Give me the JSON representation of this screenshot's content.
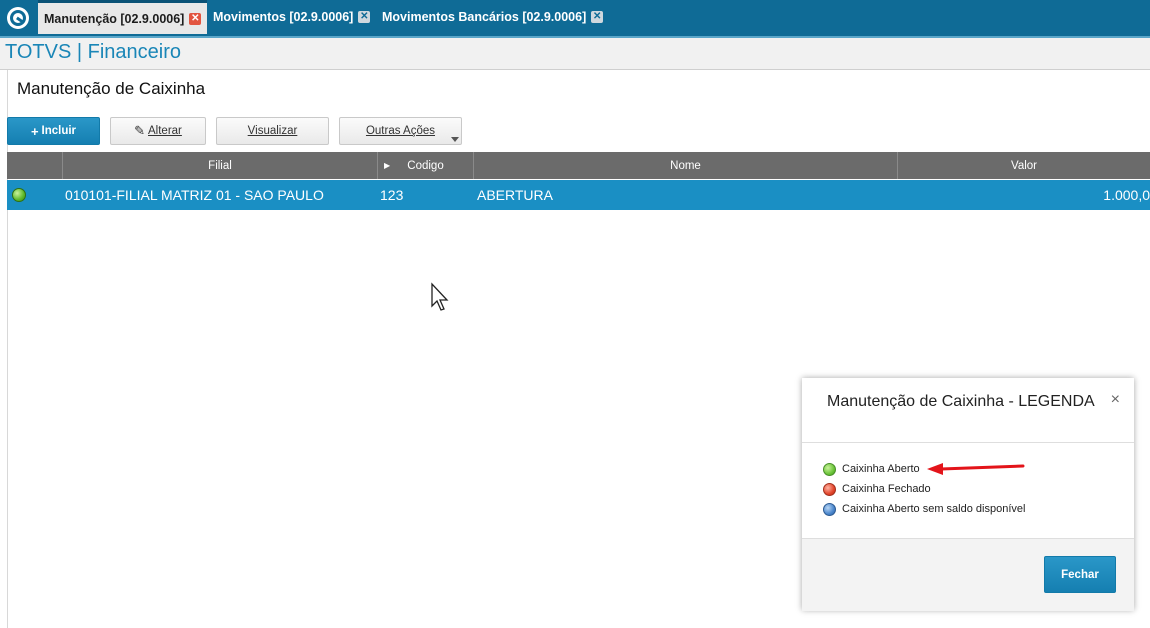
{
  "tabs": [
    {
      "label": "Manutenção [02.9.0006]",
      "active": true
    },
    {
      "label": "Movimentos [02.9.0006]",
      "active": false
    },
    {
      "label": "Movimentos Bancários [02.9.0006]",
      "active": false
    }
  ],
  "module": {
    "title": "TOTVS | Financeiro"
  },
  "page": {
    "title": "Manutenção de Caixinha"
  },
  "toolbar": {
    "incluir": "Incluir",
    "alterar": "Alterar",
    "visualizar": "Visualizar",
    "outras_acoes": "Outras Ações"
  },
  "grid": {
    "columns": [
      "",
      "Filial",
      "Codigo",
      "Nome",
      "Valor"
    ],
    "rows": [
      {
        "status": "green",
        "filial": "010101-FILIAL MATRIZ 01 - SAO PAULO",
        "codigo": "123",
        "nome": "ABERTURA",
        "valor": "1.000,0"
      }
    ]
  },
  "legend_dialog": {
    "title": "Manutenção de Caixinha - LEGENDA",
    "close_icon": "×",
    "items": [
      {
        "color": "green",
        "label": "Caixinha Aberto"
      },
      {
        "color": "red",
        "label": "Caixinha Fechado"
      },
      {
        "color": "blue",
        "label": "Caixinha Aberto sem saldo disponível"
      }
    ],
    "button": "Fechar"
  },
  "colors": {
    "accent": "#1a8fc4",
    "topbar": "#0f6b96",
    "arrow": "#e3141a"
  }
}
